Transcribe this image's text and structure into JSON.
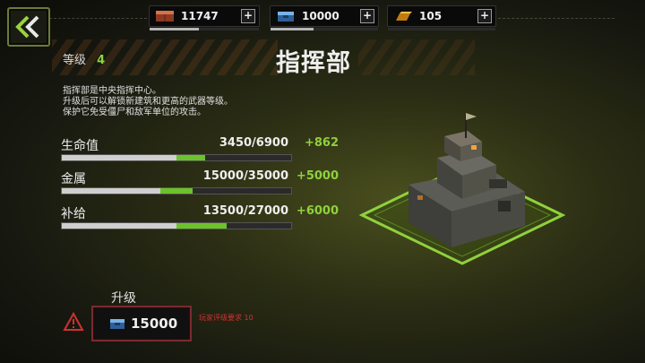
{
  "resources": [
    {
      "name": "brick-icon",
      "value": "11747",
      "bar_fill": 0.45,
      "color": "#c7603a"
    },
    {
      "name": "metal-crate-icon",
      "value": "10000",
      "bar_fill": 0.4,
      "color": "#4a86c6"
    },
    {
      "name": "gold-bar-icon",
      "value": "105",
      "bar_fill": 0.0,
      "color": "#e6a020"
    }
  ],
  "building": {
    "level_label": "等级",
    "level": "4",
    "title": "指挥部",
    "description": [
      "指挥部是中央指挥中心。",
      "升级后可以解锁新建筑和更高的武器等级。",
      "保护它免受僵尸和敌军单位的攻击。"
    ]
  },
  "stats": [
    {
      "name": "生命值",
      "value": "3450/6900",
      "gain": "+862",
      "current_fraction": 0.5,
      "after_fraction": 0.625
    },
    {
      "name": "金属",
      "value": "15000/35000",
      "gain": "+5000",
      "current_fraction": 0.43,
      "after_fraction": 0.57
    },
    {
      "name": "补给",
      "value": "13500/27000",
      "gain": "+6000",
      "current_fraction": 0.5,
      "after_fraction": 0.72
    }
  ],
  "upgrade": {
    "label": "升级",
    "cost": "15000",
    "requirement": "玩家评级要求 10"
  },
  "colors": {
    "accent_green": "#8fd13d",
    "warn_red": "#d0312f"
  }
}
